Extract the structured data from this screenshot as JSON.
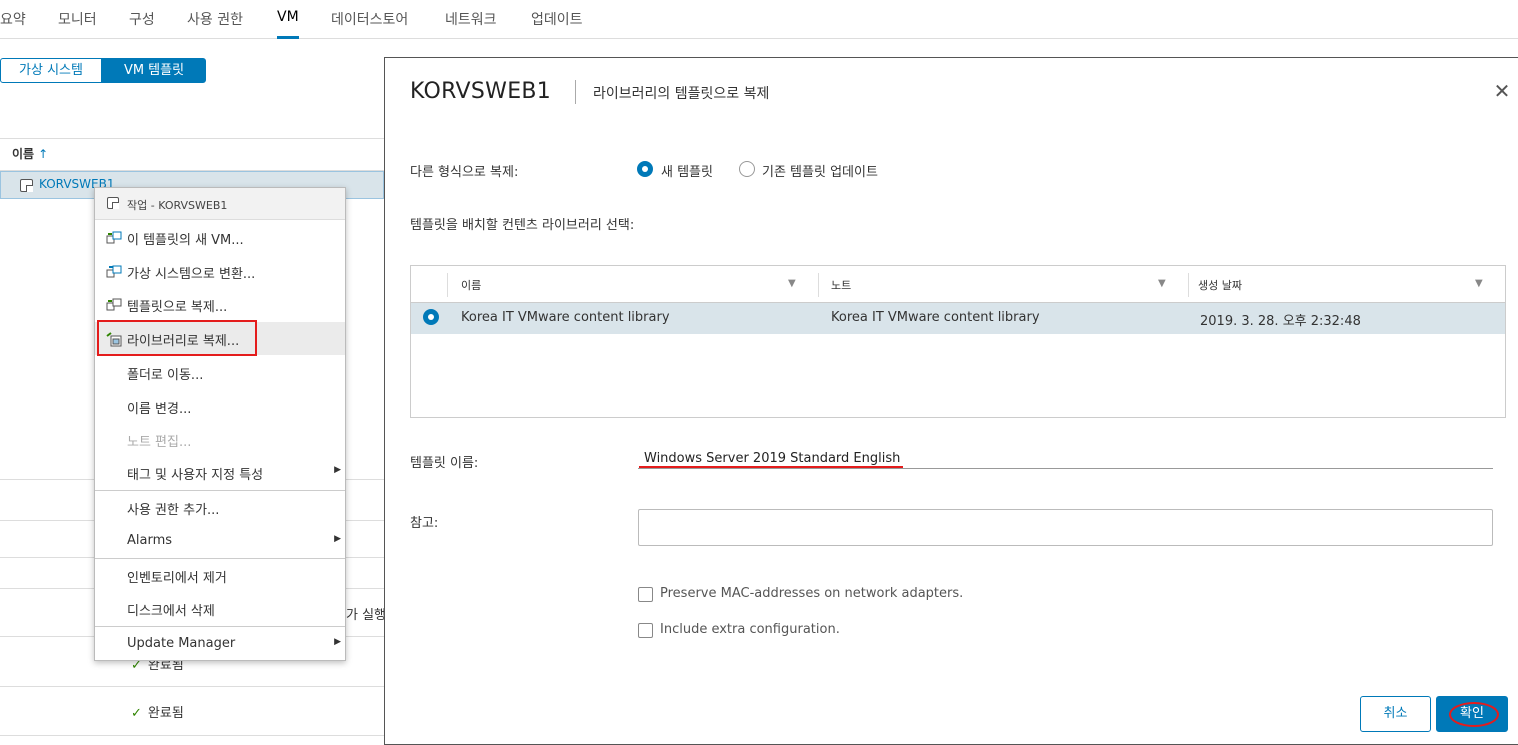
{
  "top_tabs": [
    "요약",
    "모니터",
    "구성",
    "사용 권한",
    "VM",
    "데이터스토어",
    "네트워크",
    "업데이트"
  ],
  "active_tab": "VM",
  "view_toggle": {
    "virtual_machines": "가상 시스템",
    "vm_templates": "VM 템플릿"
  },
  "list": {
    "name_header": "이름",
    "sort_arrow": "↑",
    "selected_item": "KORVSWEB1",
    "cut_off_text": "가 실행",
    "completed_rows": [
      "완료됨",
      "완료됨"
    ]
  },
  "context_menu": {
    "header": "작업 - KORVSWEB1",
    "items": [
      {
        "label": "이 템플릿의 새 VM...",
        "icon": "new-vm-from-template-icon"
      },
      {
        "label": "가상 시스템으로 변환...",
        "icon": "convert-to-vm-icon"
      },
      {
        "label": "템플릿으로 복제...",
        "icon": "clone-to-template-icon"
      },
      {
        "label": "라이브러리로 복제...",
        "icon": "clone-to-library-icon"
      },
      {
        "label": "폴더로 이동..."
      },
      {
        "label": "이름 변경..."
      },
      {
        "label": "노트 편집..."
      },
      {
        "label": "태그 및 사용자 지정 특성"
      },
      {
        "label": "사용 권한 추가..."
      },
      {
        "label": "Alarms"
      },
      {
        "label": "인벤토리에서 제거"
      },
      {
        "label": "디스크에서 삭제"
      },
      {
        "label": "Update Manager"
      }
    ]
  },
  "dialog": {
    "title": "KORVSWEB1",
    "subtitle": "라이브러리의 템플릿으로 복제",
    "clone_as_label": "다른 형식으로 복제:",
    "clone_as_options": [
      "새 템플릿",
      "기존 템플릿 업데이트"
    ],
    "clone_as_selected": "새 템플릿",
    "library_select_label": "템플릿을 배치할 컨텐츠 라이브러리 선택:",
    "grid": {
      "columns": [
        "이름",
        "노트",
        "생성 날짜"
      ],
      "rows": [
        {
          "name": "Korea IT VMware content library",
          "notes": "Korea IT VMware content library",
          "created": "2019. 3. 28. 오후 2:32:48",
          "selected": true
        }
      ]
    },
    "template_name_label": "템플릿 이름:",
    "template_name_value": "Windows Server 2019 Standard English",
    "notes_label": "참고:",
    "notes_value": "",
    "checkboxes": [
      {
        "label": "Preserve MAC-addresses on network adapters.",
        "checked": false
      },
      {
        "label": "Include extra configuration.",
        "checked": false
      }
    ],
    "cancel_button": "취소",
    "ok_button": "확인"
  },
  "colors": {
    "accent": "#0079b8",
    "selected_row": "#d9e4ea",
    "annotation": "#e41c1c",
    "success": "#2f8400"
  }
}
